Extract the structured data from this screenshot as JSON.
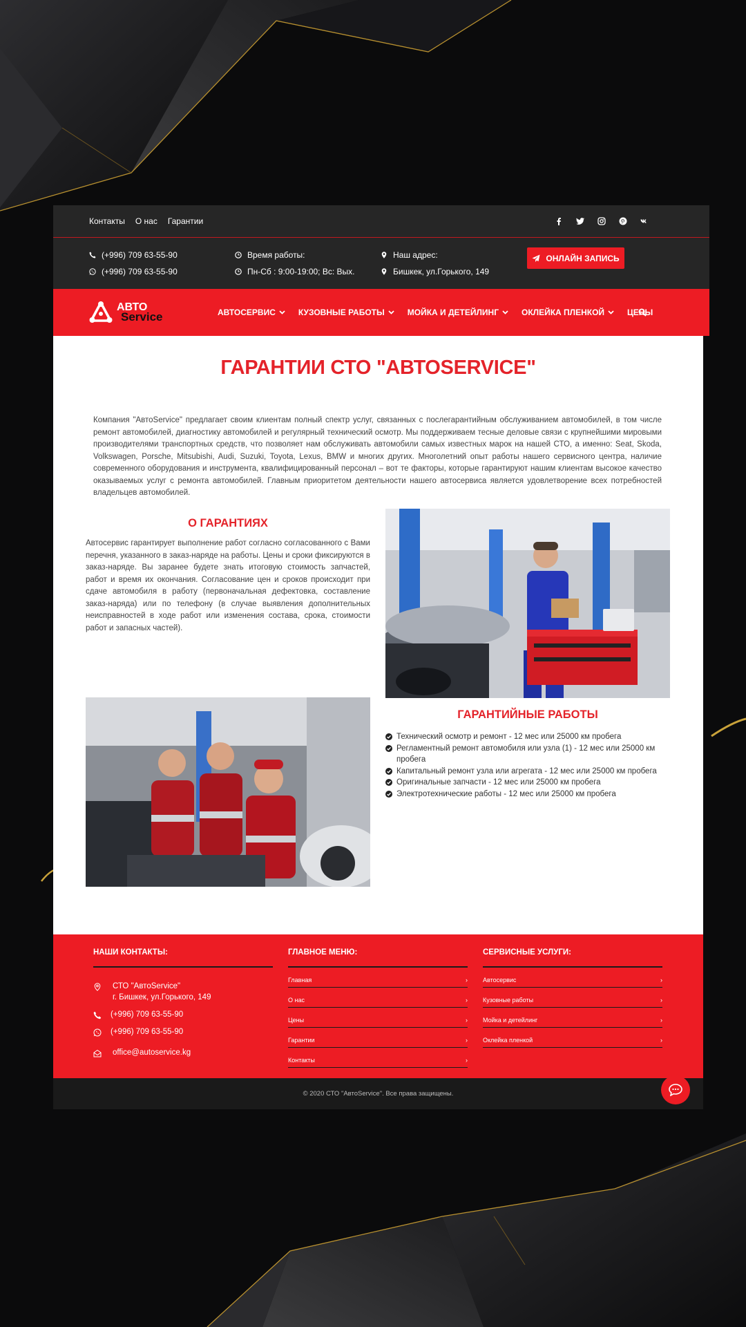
{
  "topbar": {
    "links": [
      "Контакты",
      "О нас",
      "Гарантии"
    ]
  },
  "info": {
    "phone1": "(+996) 709 63-55-90",
    "phone2": "(+996) 709 63-55-90",
    "hours_label": "Время работы:",
    "hours_value": "Пн-Сб : 9:00-19:00; Вс: Вых.",
    "address_label": "Наш адрес:",
    "address_value": "Бишкек, ул.Горького, 149",
    "cta": "ОНЛАЙН ЗАПИСЬ"
  },
  "logo": {
    "line1": "АВТО",
    "line2": "Service"
  },
  "nav": [
    "АВТОСЕРВИС",
    "КУЗОВНЫЕ РАБОТЫ",
    "МОЙКА И ДЕТЕЙЛИНГ",
    "ОКЛЕЙКА ПЛЕНКОЙ",
    "ЦЕНЫ"
  ],
  "page": {
    "title": "ГАРАНТИИ СТО \"АВТОSERVICE\"",
    "intro": "Компания \"АвтоService\" предлагает своим клиентам полный спектр услуг, связанных с послегарантийным обслуживанием автомобилей, в том числе ремонт автомобилей, диагностику автомобилей и регулярный технический осмотр. Мы поддерживаем тесные деловые связи с крупнейшими мировыми производителями транспортных средств, что позволяет нам обслуживать автомобили самых известных марок на нашей СТО, а именно: Seat, Skoda, Volkswagen, Porsche, Mitsubishi, Audi, Suzuki, Toyota, Lexus, BMW и многих других. Многолетний опыт работы нашего сервисного центра, наличие современного оборудования и инструмента, квалифицированный персонал – вот те факторы, которые гарантируют нашим клиентам высокое качество оказываемых услуг с ремонта автомобилей. Главным приоритетом деятельности нашего автосервиса является удовлетворение всех потребностей владельцев автомобилей.",
    "about_title": "О ГАРАНТИЯХ",
    "about_text": "Автосервис гарантирует выполнение работ согласно согласованного с Вами перечня, указанного в заказ-наряде на работы. Цены и сроки фиксируются в заказ-наряде. Вы заранее будете знать итоговую стоимость запчастей, работ и время их окончания. Согласование цен и сроков происходит при сдаче автомобиля в работу (первоначальная дефектовка, составление заказ-наряда) или по телефону (в случае выявления дополнительных неисправностей в ходе работ или изменения состава, срока, стоимости работ и запасных частей).",
    "works_title": "ГАРАНТИЙНЫЕ РАБОТЫ",
    "works": [
      "Технический осмотр и ремонт - 12 мес или 25000 км пробега",
      "Регламентный ремонт автомобиля или узла (1) - 12 мес или 25000 км пробега",
      "Капитальный ремонт узла или агрегата - 12 мес или 25000 км пробега",
      "Оригинальные запчасти - 12 мес или 25000 км пробега",
      "Электротехнические работы - 12 мес или 25000 км пробега"
    ]
  },
  "footer": {
    "contacts_title": "НАШИ КОНТАКТЫ:",
    "company": "СТО \"АвтоService\"",
    "address": "г. Бишкек, ул.Горького, 149",
    "phone1": "(+996) 709 63-55-90",
    "phone2": "(+996) 709 63-55-90",
    "email": "office@autoservice.kg",
    "menu_title": "ГЛАВНОЕ МЕНЮ:",
    "menu": [
      "Главная",
      "О нас",
      "Цены",
      "Гарантии",
      "Контакты"
    ],
    "services_title": "СЕРВИСНЫЕ УСЛУГИ:",
    "services": [
      "Автосервис",
      "Кузовные работы",
      "Мойка и детейлинг",
      "Оклейка пленкой"
    ],
    "copyright": "© 2020 СТО \"АвтоService\". Все права защищены."
  },
  "colors": {
    "accent": "#ed1c24",
    "dark": "#262626",
    "title_red": "#e4232a"
  }
}
